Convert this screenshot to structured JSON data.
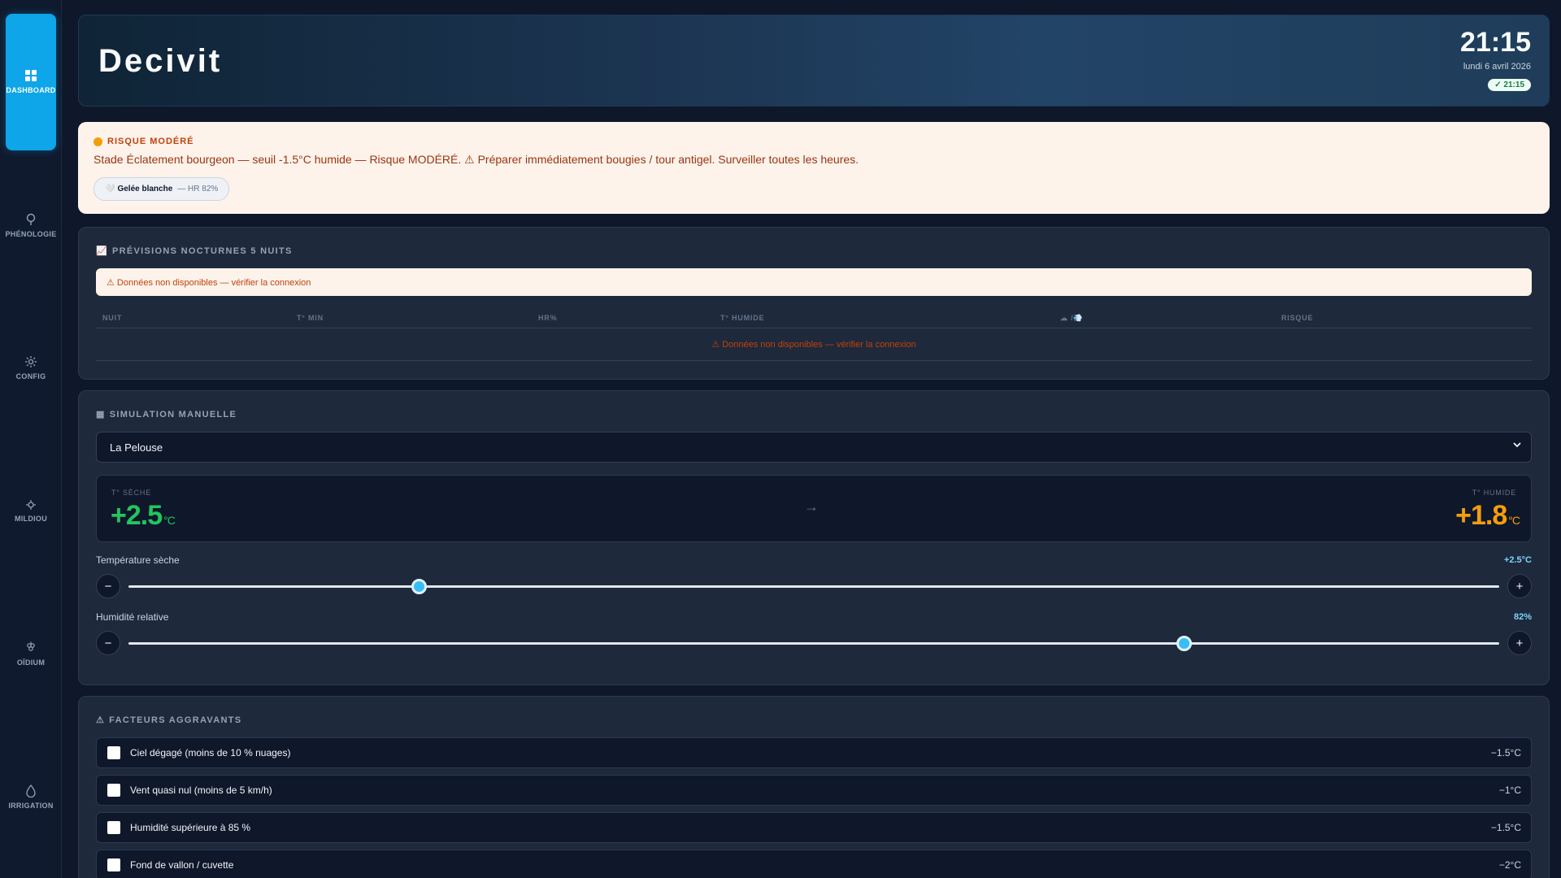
{
  "sidebar": {
    "items": [
      {
        "label": "DASHBOARD",
        "icon": "grid-icon",
        "active": true
      },
      {
        "label": "PHÉNOLOGIE",
        "icon": "sprout-icon"
      },
      {
        "label": "CONFIG",
        "icon": "gear-icon"
      },
      {
        "label": "MILDIOU",
        "icon": "bug-icon"
      },
      {
        "label": "OÏDIUM",
        "icon": "grapes-icon"
      },
      {
        "label": "IRRIGATION",
        "icon": "droplet-icon"
      }
    ]
  },
  "header": {
    "title": "Decivit",
    "time": "21:15",
    "date": "lundi 6 avril 2026",
    "sync": "✓ 21:15"
  },
  "alert": {
    "level": "RISQUE MODÉRÉ",
    "message": "Stade Éclatement bourgeon — seuil -1.5°C humide — Risque MODÉRÉ. ⚠ Préparer immédiatement bougies / tour antigel. Surveiller toutes les heures.",
    "chip_icon": "🤍",
    "chip_label": "Gelée blanche",
    "chip_sub": "— HR 82%",
    "level_color": "#f59e0b"
  },
  "forecast": {
    "icon": "📈",
    "title": "PRÉVISIONS NOCTURNES 5 NUITS",
    "warning": "⚠ Données non disponibles — vérifier la connexion",
    "columns": [
      "NUIT",
      "T° MIN",
      "HR%",
      "T° HUMIDE",
      "☁ /💨",
      "RISQUE"
    ],
    "empty_message": "⚠ Données non disponibles — vérifier la connexion"
  },
  "simulation": {
    "icon": "▦",
    "title": "SIMULATION MANUELLE",
    "parcel": "La Pelouse",
    "dry_label": "T° SÈCHE",
    "dry_value": "+2.5",
    "dry_unit": "°C",
    "wet_label": "T° HUMIDE",
    "wet_value": "+1.8",
    "wet_unit": "°C",
    "arrow": "→",
    "temp_slider": {
      "label": "Température sèche",
      "display": "+2.5°C",
      "fraction": 0.212
    },
    "hr_slider": {
      "label": "Humidité relative",
      "display": "82%",
      "fraction": 0.77
    },
    "minus": "−",
    "plus": "+",
    "colors": {
      "dry": "#22c55e",
      "wet": "#f59e0b",
      "accent": "#38bdf8"
    }
  },
  "factors": {
    "icon": "⚠",
    "title": "FACTEURS AGGRAVANTS",
    "items": [
      {
        "label": "Ciel dégagé (moins de 10 % nuages)",
        "value": "−1.5°C"
      },
      {
        "label": "Vent quasi nul (moins de 5 km/h)",
        "value": "−1°C"
      },
      {
        "label": "Humidité supérieure à 85 %",
        "value": "−1.5°C"
      },
      {
        "label": "Fond de vallon / cuvette",
        "value": "−2°C"
      }
    ]
  }
}
